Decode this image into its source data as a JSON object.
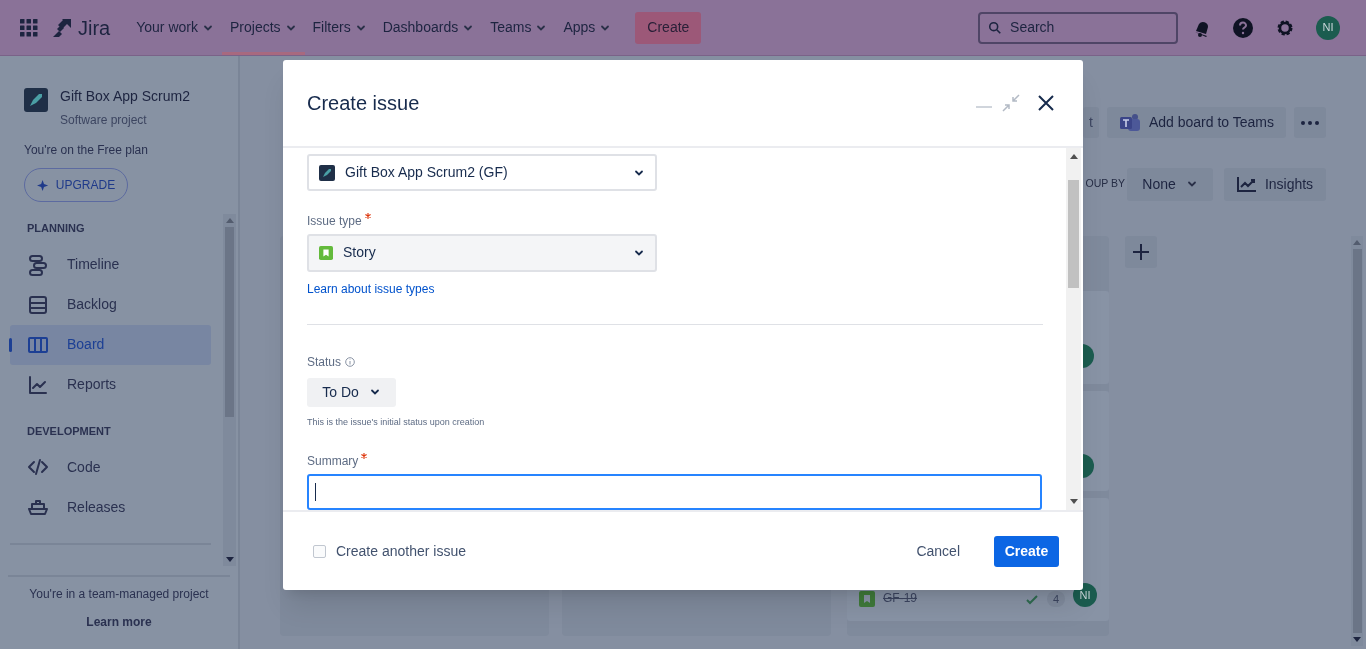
{
  "nav": {
    "items": [
      {
        "label": "Your work",
        "selected": false
      },
      {
        "label": "Projects",
        "selected": true
      },
      {
        "label": "Filters",
        "selected": false
      },
      {
        "label": "Dashboards",
        "selected": false
      },
      {
        "label": "Teams",
        "selected": false
      },
      {
        "label": "Apps",
        "selected": false
      }
    ],
    "product": "Jira",
    "create": "Create",
    "search": {
      "placeholder": "Search"
    },
    "avatar": "NI"
  },
  "sidebar": {
    "project": {
      "name": "Gift Box App Scrum2",
      "type": "Software project"
    },
    "plan": "You're on the Free plan",
    "upgrade": "UPGRADE",
    "sections": [
      {
        "title": "PLANNING",
        "items": [
          {
            "label": "Timeline",
            "kind": "timeline",
            "selected": false
          },
          {
            "label": "Backlog",
            "kind": "backlog",
            "selected": false
          },
          {
            "label": "Board",
            "kind": "board",
            "selected": true
          },
          {
            "label": "Reports",
            "kind": "reports",
            "selected": false
          }
        ]
      },
      {
        "title": "DEVELOPMENT",
        "items": [
          {
            "label": "Code",
            "kind": "code",
            "selected": false
          },
          {
            "label": "Releases",
            "kind": "releases",
            "selected": false
          }
        ]
      }
    ],
    "footer": {
      "text": "You're in a team-managed project",
      "link": "Learn more"
    }
  },
  "board": {
    "partial_button": "t",
    "teams_button": "Add board to Teams",
    "group_by_label": "OUP BY",
    "group_by": "None",
    "insights": "Insights",
    "card": {
      "key": "GF-19",
      "done": true,
      "count": "4",
      "avatar": "NI"
    }
  },
  "modal": {
    "title": "Create issue",
    "project": {
      "value": "Gift Box App Scrum2 (GF)"
    },
    "issue_type": {
      "label": "Issue type",
      "required": true,
      "value": "Story",
      "link": "Learn about issue types"
    },
    "status": {
      "label": "Status",
      "value": "To Do",
      "help": "This is the issue's initial status upon creation"
    },
    "summary": {
      "label": "Summary",
      "required": true,
      "focused": true
    },
    "create_another": {
      "label": "Create another issue",
      "checked": false
    },
    "cancel": "Cancel",
    "submit": "Create"
  }
}
